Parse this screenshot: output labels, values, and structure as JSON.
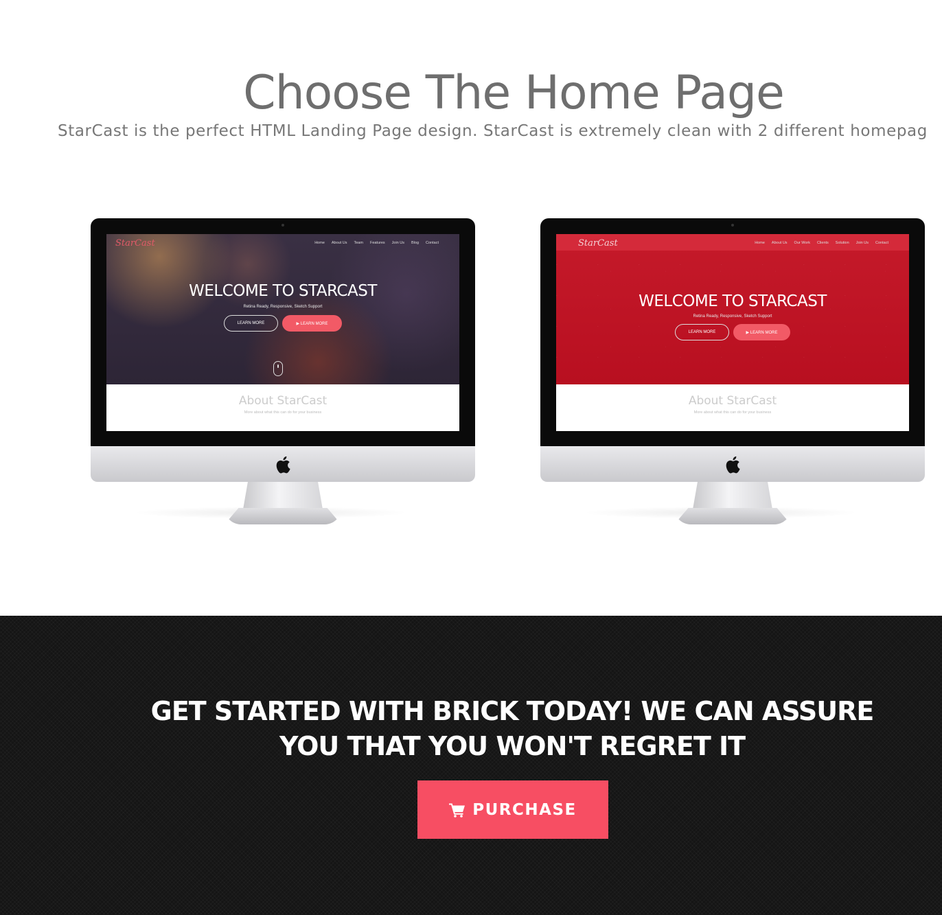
{
  "choose": {
    "title": "Choose The Home Page",
    "subtitle": "StarCast is the perfect HTML Landing Page design. StarCast is extremely clean with 2 different homepag"
  },
  "preview_1": {
    "logo": "StarCast",
    "nav": [
      "Home",
      "About Us",
      "Team",
      "Features",
      "Join Us",
      "Blog",
      "Contact"
    ],
    "hero_title": "WELCOME TO STARCAST",
    "hero_tagline": "Retina Ready, Responsive, Sketch Support",
    "btn_outline": "LEARN MORE",
    "btn_fill": "▶ LEARN MORE",
    "about_title": "About StarCast",
    "about_sub": "More about what this can do for your business"
  },
  "preview_2": {
    "logo": "StarCast",
    "nav": [
      "Home",
      "About Us",
      "Our Work",
      "Clients",
      "Solution",
      "Join Us",
      "Contact"
    ],
    "hero_title": "WELCOME TO STARCAST",
    "hero_tagline": "Retina Ready, Responsive, Sketch Support",
    "btn_outline": "LEARN MORE",
    "btn_fill": "▶ LEARN MORE",
    "about_title": "About StarCast",
    "about_sub": "More about what this can do for your business"
  },
  "cta": {
    "line1": "GET STARTED WITH BRICK TODAY! WE CAN ASSURE",
    "line2": "YOU THAT YOU WON'T REGRET IT",
    "button_label": "PURCHASE",
    "button_icon": "shopping-cart-icon"
  },
  "colors": {
    "accent": "#f74e63",
    "dark_bg": "#151515",
    "red_theme": "#c51a2a"
  }
}
